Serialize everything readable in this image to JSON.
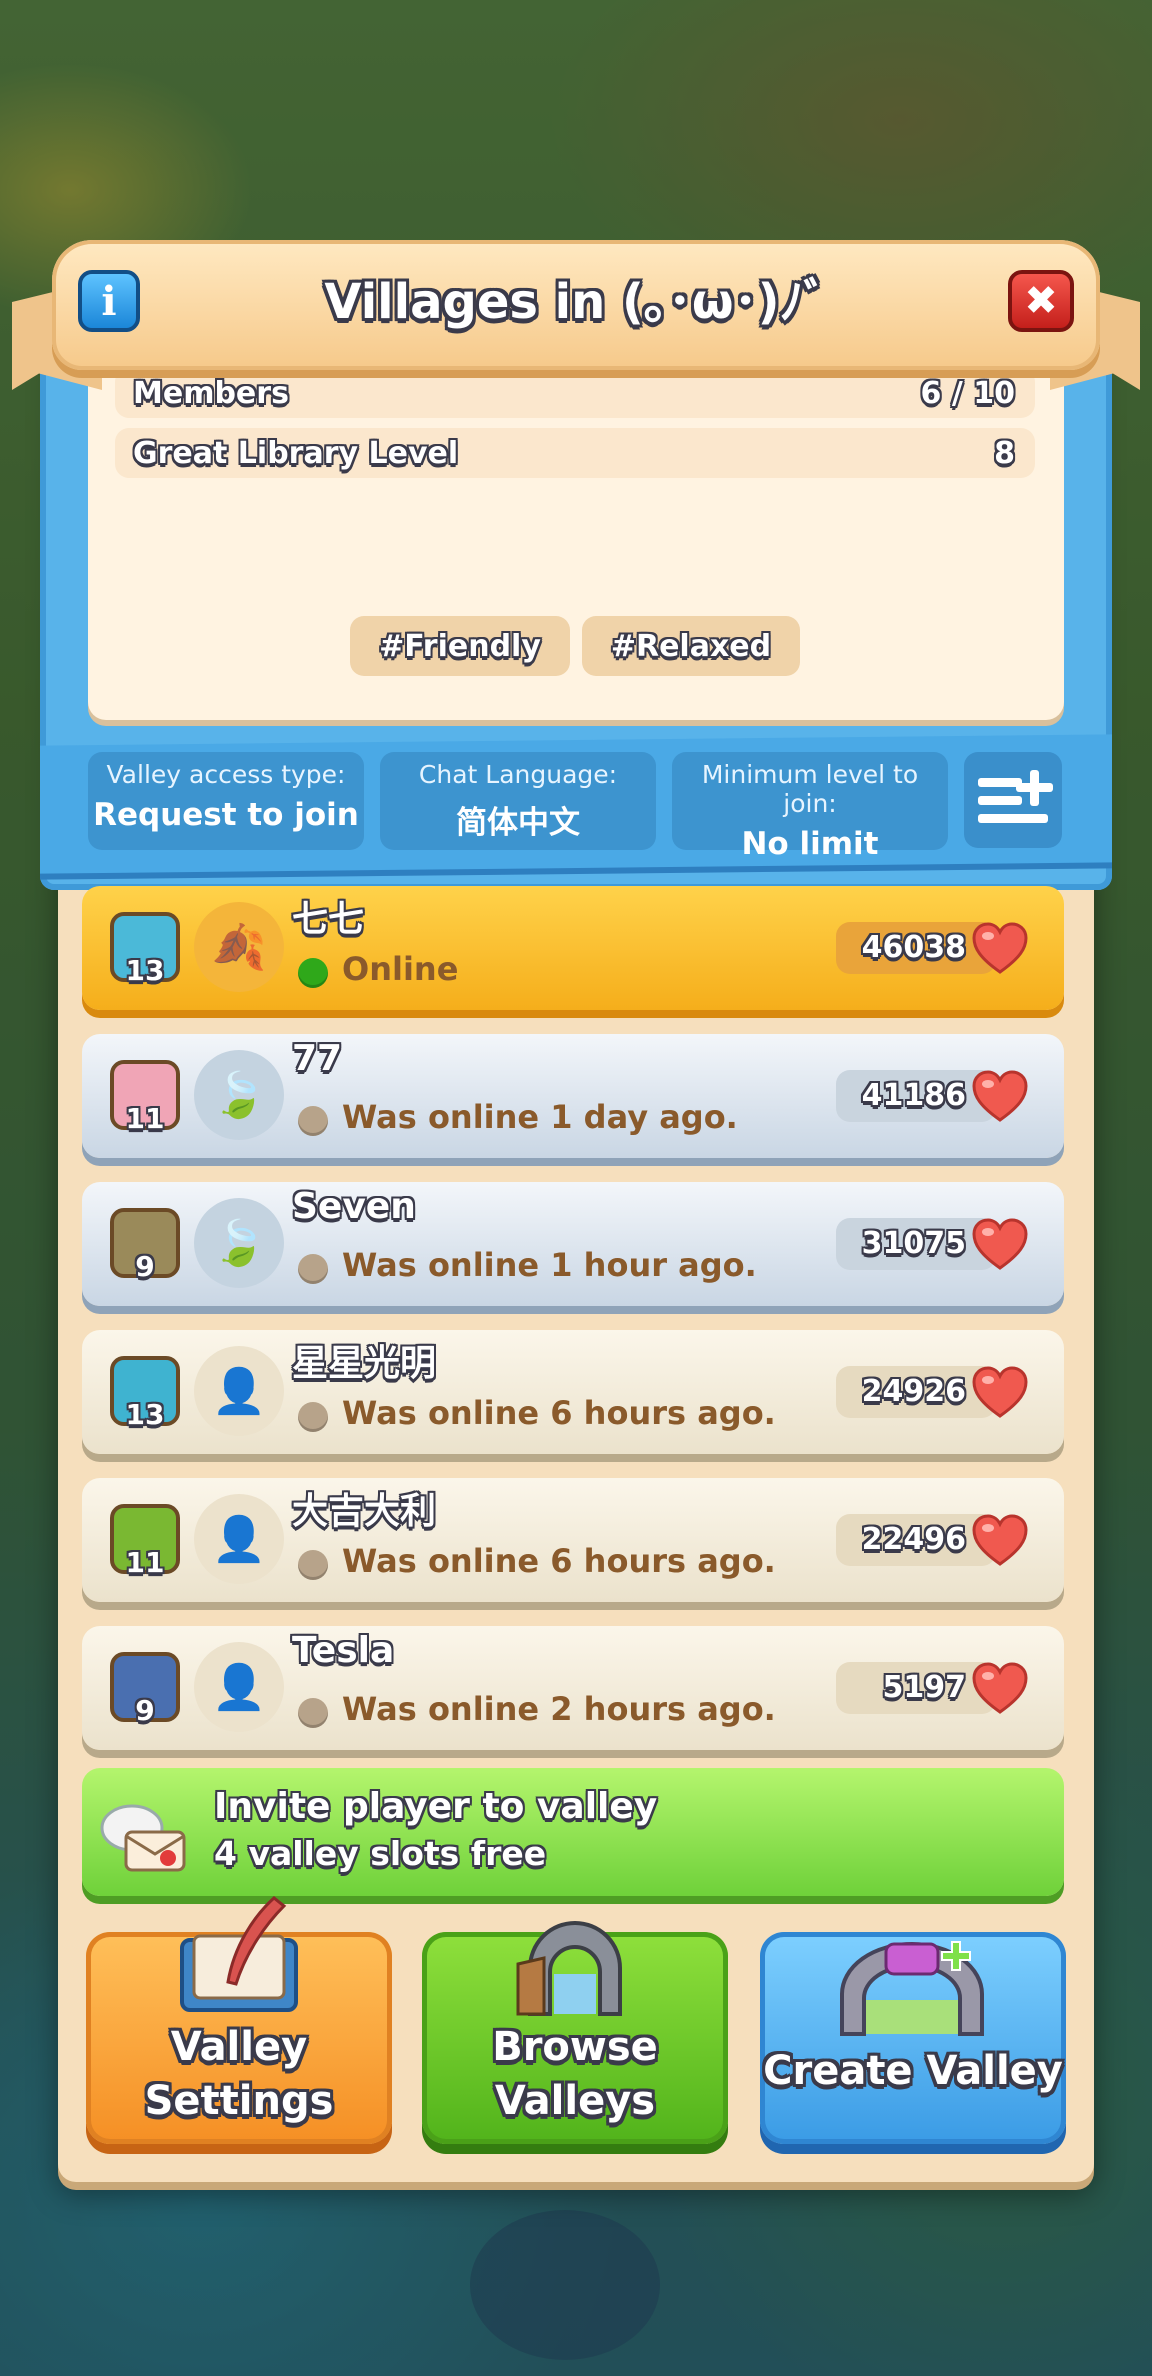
{
  "header": {
    "title": "Villages in (｡･ω･)ﾉﾞ",
    "info_icon": "info-icon",
    "close_icon": "close-icon"
  },
  "stats": [
    {
      "label": "Members",
      "value": "6 / 10"
    },
    {
      "label": "Great Library Level",
      "value": "8"
    }
  ],
  "tags": [
    "#Friendly",
    "#Relaxed"
  ],
  "filters": [
    {
      "label": "Valley access type:",
      "value": "Request to join"
    },
    {
      "label": "Chat Language:",
      "value": "简体中文"
    },
    {
      "label": "Minimum level to join:",
      "value": "No limit"
    }
  ],
  "members": [
    {
      "name": "七七",
      "level": "13",
      "status": "Online",
      "score": "46038",
      "rank": "leader",
      "style": "gold",
      "status_color": "#2fa81a"
    },
    {
      "name": "77",
      "level": "11",
      "status": "Was online 1 day ago.",
      "score": "41186",
      "rank": "elder",
      "style": "silver",
      "status_color": "#b7a38a"
    },
    {
      "name": "Seven",
      "level": "9",
      "status": "Was online 1 hour ago.",
      "score": "31075",
      "rank": "elder",
      "style": "silver",
      "status_color": "#b7a38a"
    },
    {
      "name": "星星光明",
      "level": "13",
      "status": "Was online 6 hours ago.",
      "score": "24926",
      "rank": "member",
      "style": "plain",
      "status_color": "#b7a38a"
    },
    {
      "name": "大吉大利",
      "level": "11",
      "status": "Was online 6 hours ago.",
      "score": "22496",
      "rank": "member",
      "style": "plain",
      "status_color": "#b7a38a"
    },
    {
      "name": "Tesla",
      "level": "9",
      "status": "Was online 2 hours ago.",
      "score": "5197",
      "rank": "member",
      "style": "plain",
      "status_color": "#b7a38a"
    }
  ],
  "invite": {
    "line1": "Invite player to valley",
    "line2": "4 valley slots free"
  },
  "buttons": {
    "settings_l1": "Valley",
    "settings_l2": "Settings",
    "browse_l1": "Browse",
    "browse_l2": "Valleys",
    "create": "Create Valley"
  },
  "colors": {
    "accent_blue": "#4aa9e6",
    "gold_row": "#f5ae1b",
    "green_button": "#6fd13a",
    "close_red": "#c41f1b"
  }
}
